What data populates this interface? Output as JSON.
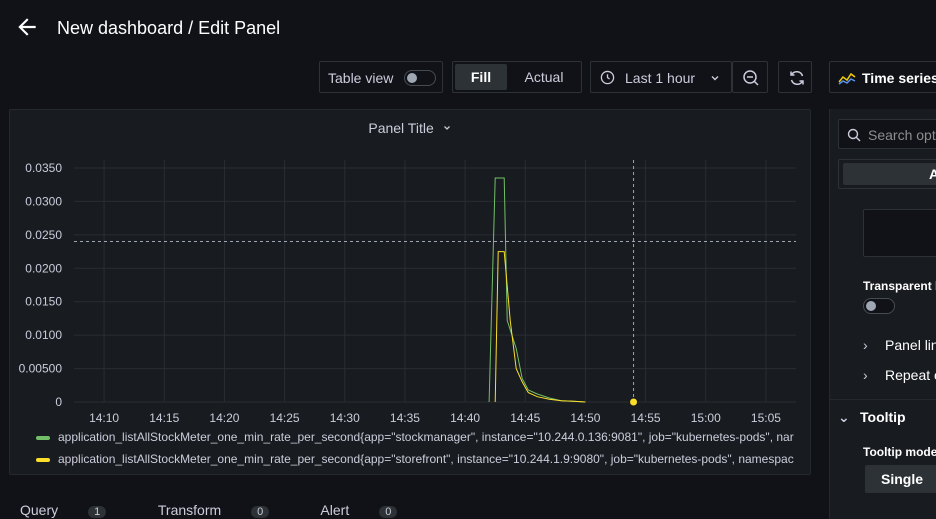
{
  "header": {
    "title": "New dashboard / Edit Panel"
  },
  "toolbar": {
    "table_view_label": "Table view",
    "fill_label": "Fill",
    "actual_label": "Actual",
    "time_range_label": "Last 1 hour",
    "visualization_label": "Time series"
  },
  "panel": {
    "title": "Panel Title",
    "legend": [
      {
        "label": "application_listAllStockMeter_one_min_rate_per_second{app=\"stockmanager\", instance=\"10.244.0.136:9081\", job=\"kubernetes-pods\", nar",
        "color": "#73bf69"
      },
      {
        "label": "application_listAllStockMeter_one_min_rate_per_second{app=\"storefront\", instance=\"10.244.1.9:9080\", job=\"kubernetes-pods\", namespac",
        "color": "#fade2a"
      }
    ]
  },
  "chart_data": {
    "type": "line",
    "title": "Panel Title",
    "y_ticks": [
      "0.0350",
      "0.0300",
      "0.0250",
      "0.0200",
      "0.0150",
      "0.0100",
      "0.00500",
      "0"
    ],
    "x_ticks": [
      "14:10",
      "14:15",
      "14:20",
      "14:25",
      "14:30",
      "14:35",
      "14:40",
      "14:45",
      "14:50",
      "14:55",
      "15:00",
      "15:05"
    ],
    "ylim": [
      0,
      0.035
    ],
    "grid": true,
    "legend_position": "bottom",
    "crosshair": {
      "x": "14:54",
      "y": 0.024
    },
    "series": [
      {
        "name": "application_listAllStockMeter_one_min_rate_per_second{app=\"stockmanager\", instance=\"10.244.0.136:9081\", job=\"kubernetes-pods\", nar",
        "color": "#73bf69",
        "points": [
          [
            "14:42:00",
            0
          ],
          [
            "14:42:30",
            0.0335
          ],
          [
            "14:43:15",
            0.0335
          ],
          [
            "14:43:30",
            0.0122
          ],
          [
            "14:44:15",
            0.008
          ],
          [
            "14:44:45",
            0.0035
          ],
          [
            "14:45:15",
            0.0018
          ],
          [
            "14:46",
            0.0012
          ],
          [
            "14:47",
            0.0006
          ],
          [
            "14:48",
            0.0002
          ],
          [
            "14:49",
            0.0001
          ],
          [
            "14:50",
            0
          ]
        ]
      },
      {
        "name": "application_listAllStockMeter_one_min_rate_per_second{app=\"storefront\", instance=\"10.244.1.9:9080\", job=\"kubernetes-pods\", namespac",
        "color": "#fade2a",
        "points": [
          [
            "14:42:30",
            0
          ],
          [
            "14:42:45",
            0.0225
          ],
          [
            "14:43:15",
            0.0225
          ],
          [
            "14:43:45",
            0.0122
          ],
          [
            "14:44:15",
            0.005
          ],
          [
            "14:44:45",
            0.003
          ],
          [
            "14:45:15",
            0.0014
          ],
          [
            "14:46",
            0.0008
          ],
          [
            "14:47",
            0.0004
          ],
          [
            "14:48",
            0.0002
          ],
          [
            "14:49",
            0.0001
          ],
          [
            "14:50",
            0
          ]
        ]
      }
    ]
  },
  "options": {
    "search_placeholder": "Search opti",
    "all_label": "A",
    "transparent_label": "Transparent b",
    "panel_links_label": "Panel lin",
    "repeat_label": "Repeat o",
    "tooltip_section": "Tooltip",
    "tooltip_mode_label": "Tooltip mode",
    "tooltip_mode_value": "Single"
  },
  "bottom_tabs": [
    {
      "label": "Query",
      "count": "1"
    },
    {
      "label": "Transform",
      "count": "0"
    },
    {
      "label": "Alert",
      "count": "0"
    }
  ]
}
